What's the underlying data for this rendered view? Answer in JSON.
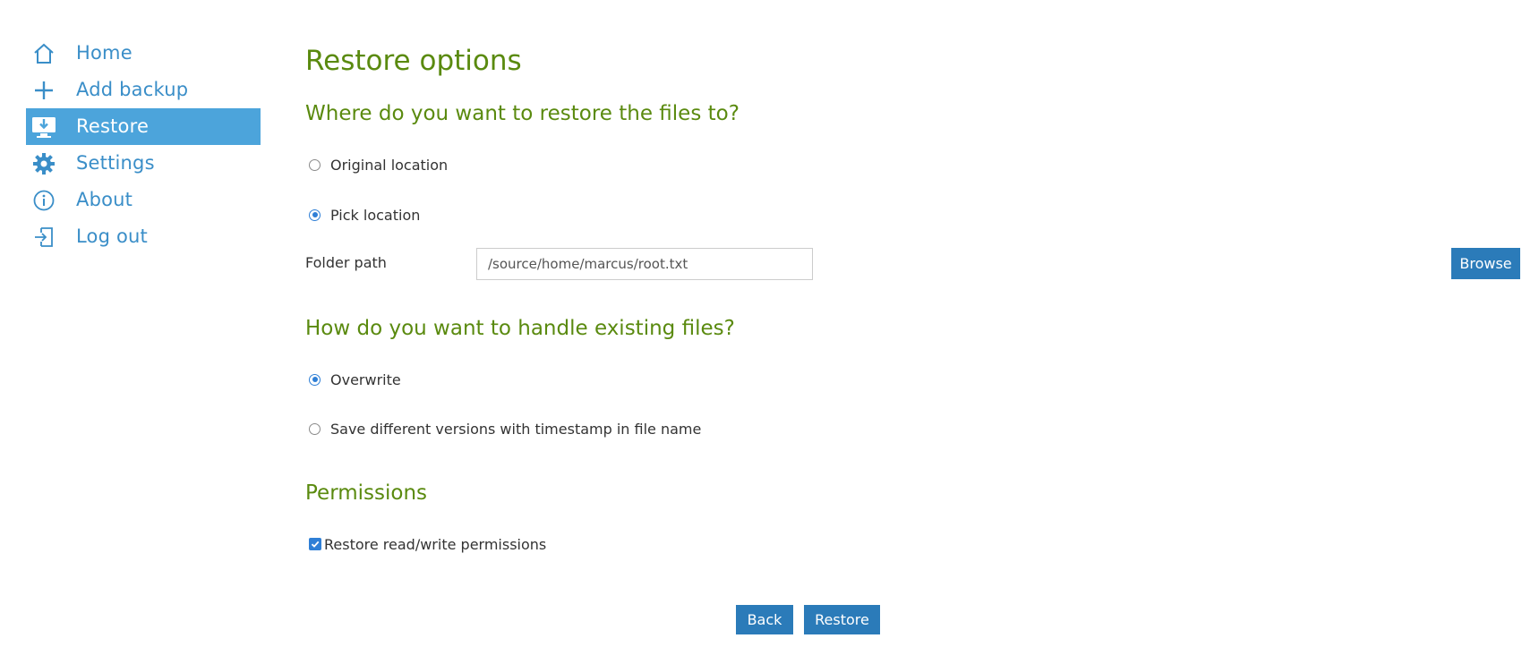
{
  "sidebar": {
    "items": [
      {
        "label": "Home",
        "icon": "home-icon",
        "active": false
      },
      {
        "label": "Add backup",
        "icon": "plus-icon",
        "active": false
      },
      {
        "label": "Restore",
        "icon": "restore-icon",
        "active": true
      },
      {
        "label": "Settings",
        "icon": "gear-icon",
        "active": false
      },
      {
        "label": "About",
        "icon": "info-icon",
        "active": false
      },
      {
        "label": "Log out",
        "icon": "logout-icon",
        "active": false
      }
    ]
  },
  "page": {
    "title": "Restore options",
    "location_section": {
      "heading": "Where do you want to restore the files to?",
      "options": [
        {
          "label": "Original location",
          "checked": false
        },
        {
          "label": "Pick location",
          "checked": true
        }
      ],
      "folder_path_label": "Folder path",
      "folder_path_value": "/source/home/marcus/root.txt",
      "browse_label": "Browse"
    },
    "existing_section": {
      "heading": "How do you want to handle existing files?",
      "options": [
        {
          "label": "Overwrite",
          "checked": true
        },
        {
          "label": "Save different versions with timestamp in file name",
          "checked": false
        }
      ]
    },
    "permissions_section": {
      "heading": "Permissions",
      "checkbox_label": "Restore read/write permissions",
      "checked": true
    },
    "back_label": "Back",
    "restore_label": "Restore"
  },
  "colors": {
    "accent": "#4ca4db",
    "nav_text": "#3a8ec8",
    "heading": "#5a8a0f",
    "button": "#2b7bb9",
    "radio": "#2f7fd6"
  }
}
